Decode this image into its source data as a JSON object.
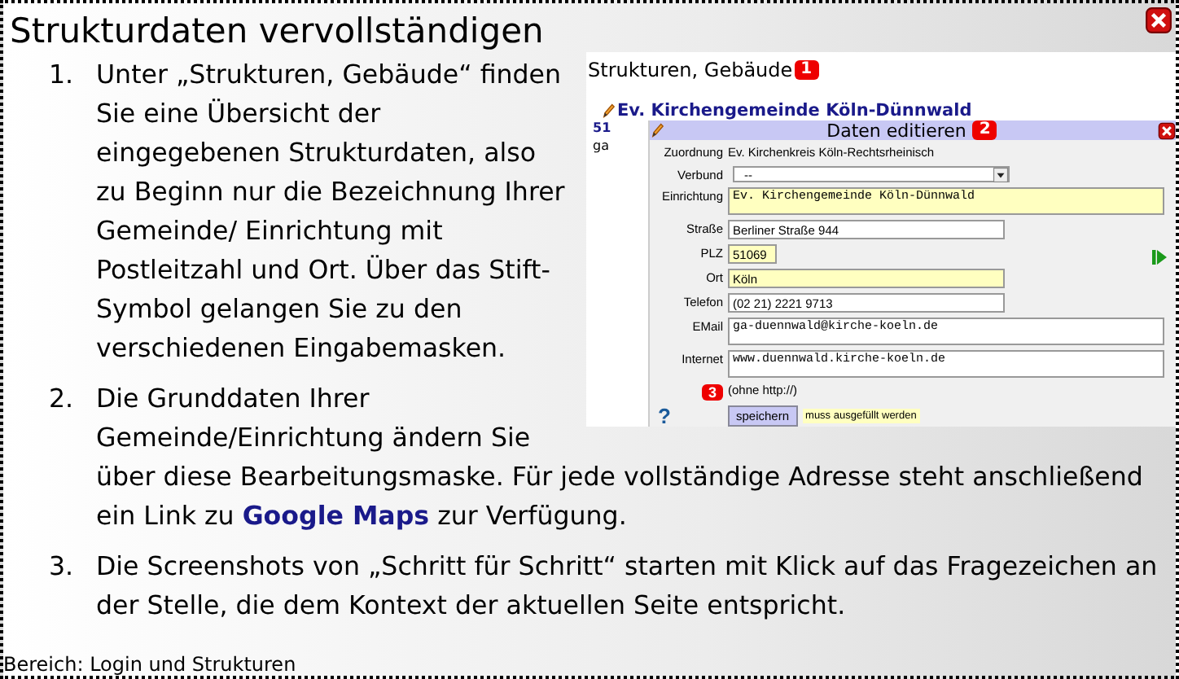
{
  "title": "Strukturdaten vervollständigen",
  "steps": [
    {
      "number": "1.",
      "parts": [
        {
          "text": "Unter „Strukturen, Gebäude“ finden Sie eine Übersicht der eingegebenen Strukturdaten, also zu Beginn nur die Bezeichnung Ihrer Gemeinde/ Einrichtung mit Postleitzahl und Ort. Über das Stift-Symbol gelangen Sie zu den verschiedenen Eingabemasken."
        }
      ]
    },
    {
      "number": "2.",
      "parts": [
        {
          "text": "Die Grunddaten Ihrer Gemeinde/Einrichtung ändern Sie über diese Bearbeitungsmaske. Für jede vollständige Adresse steht anschließend ein Link zu "
        },
        {
          "link": "Google Maps"
        },
        {
          "text": " zur Verfügung."
        }
      ]
    },
    {
      "number": "3.",
      "parts": [
        {
          "text": "Die Screenshots von „Schritt für Schritt“ starten mit Klick auf das Fragezeichen an der Stelle, die dem Kontext der aktuellen Seite entspricht."
        }
      ]
    }
  ],
  "screenshot": {
    "heading": "Strukturen, Gebäude",
    "heading_badge": "1",
    "organization": "Ev. Kirchengemeinde Köln-Dünnwald",
    "cut_texts": [
      "51",
      "ga"
    ],
    "dialog": {
      "title": "Daten editieren",
      "badge": "2",
      "fields": [
        {
          "label": "Zuordnung",
          "kind": "static",
          "value": "Ev. Kirchenkreis Köln-Rechtsrheinisch",
          "required": false
        },
        {
          "label": "Verbund",
          "kind": "select",
          "value": "--",
          "required": false
        },
        {
          "label": "Einrichtung",
          "kind": "textarea",
          "value": "Ev. Kirchengemeinde Köln-Dünnwald",
          "required": true
        },
        {
          "label": "Straße",
          "kind": "input",
          "value": "Berliner Straße 944",
          "required": false
        },
        {
          "label": "PLZ",
          "kind": "short-input",
          "value": "51069",
          "required": true
        },
        {
          "label": "Ort",
          "kind": "input",
          "value": "Köln",
          "required": true
        },
        {
          "label": "Telefon",
          "kind": "input",
          "value": "(02 21) 2221 9713",
          "required": false
        },
        {
          "label": "EMail",
          "kind": "textarea",
          "value": "ga-duennwald@kirche-koeln.de",
          "required": false
        },
        {
          "label": "Internet",
          "kind": "textarea",
          "value": "www.duennwald.kirche-koeln.de",
          "required": false
        }
      ],
      "hint": "(ohne http://)",
      "hint_badge": "3",
      "help": "?",
      "save": "speichern",
      "legend": "muss ausgefüllt werden"
    }
  },
  "footer": "Bereich: Login und Strukturen"
}
